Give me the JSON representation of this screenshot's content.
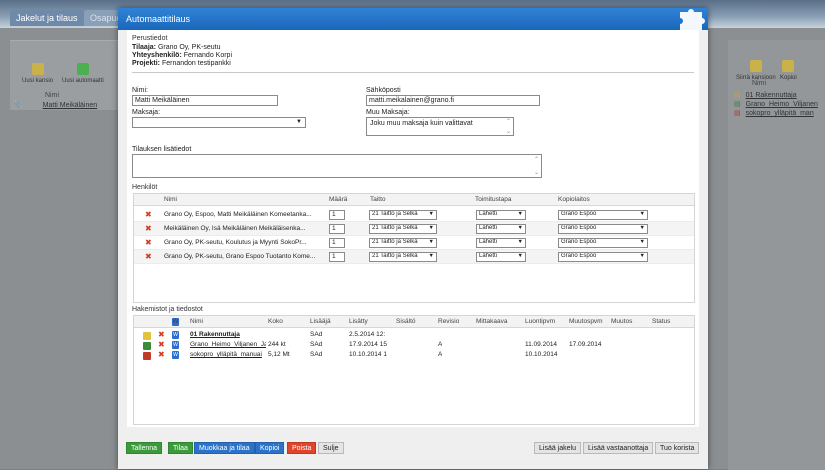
{
  "background": {
    "tabs": [
      "Jakelut ja tilaus",
      "Osapuo"
    ],
    "left_toolbar": [
      "Uusi kansio",
      "Uusi automaatti"
    ],
    "left_list_header": "Nimi",
    "left_list_item": "Matti Meikäläinen",
    "right_toolbar": [
      "Siirrä kansioon",
      "Kopioi"
    ],
    "right_list_header": "Nimi",
    "right_list_items": [
      "01 Rakennuttaja",
      "Grano_Heimo_Viljanen",
      "sokopro_ylläpitä_man"
    ]
  },
  "modal": {
    "title": "Automaattitilaus",
    "basic": {
      "heading": "Perustiedot",
      "tilaaja_label": "Tilaaja:",
      "tilaaja_value": "Grano Oy, PK-seutu",
      "contact_label": "Yhteyshenkilö:",
      "contact_value": "Fernando Korpi",
      "project_label": "Projekti:",
      "project_value": "Fernandon testipankki"
    },
    "form": {
      "name_label": "Nimi:",
      "name_value": "Matti Meikäläinen",
      "email_label": "Sähköposti",
      "email_value": "matti.meikalainen@grano.fi",
      "payer_label": "Maksaja:",
      "payer_value": "",
      "other_payer_label": "Muu Maksaja:",
      "other_payer_value": "Joku muu maksaja kuin valittavat",
      "extra_label": "Tilauksen lisätiedot",
      "extra_value": ""
    },
    "persons": {
      "heading": "Henkilöt",
      "columns": [
        "Nimi",
        "Määrä",
        "Taitto",
        "Toimitustapa",
        "Kopiolaitos"
      ],
      "rows": [
        {
          "name": "Grano Oy, Espoo, Matti Meikäläinen Komeetanka...",
          "qty": "1",
          "taitto": "21 Taitto ja Selkä",
          "delivery": "Lähetti",
          "lab": "Grano Espoo"
        },
        {
          "name": "Meikäläinen Oy, Isä Meikäläinen Meikäläisenka...",
          "qty": "1",
          "taitto": "21 Taitto ja Selkä",
          "delivery": "Lähetti",
          "lab": "Grano Espoo"
        },
        {
          "name": "Grano Oy, PK-seutu, Koulutus ja Myynti SokoPr...",
          "qty": "1",
          "taitto": "21 Taitto ja Selkä",
          "delivery": "Lähetti",
          "lab": "Grano Espoo"
        },
        {
          "name": "Grano Oy, PK-seutu, Grano Espoo Tuotanto Kome...",
          "qty": "1",
          "taitto": "21 Taitto ja Selkä",
          "delivery": "Lähetti",
          "lab": "Grano Espoo"
        }
      ]
    },
    "files": {
      "heading": "Hakemistot ja tiedostot",
      "columns": [
        "Nimi",
        "Koko",
        "Lisääjä",
        "Lisätty",
        "Sisältö",
        "Revisio",
        "Mittakaava",
        "Luontipvm",
        "Muutospvm",
        "Muutos",
        "Status"
      ],
      "rows": [
        {
          "name": "01 Rakennuttaja",
          "size": "",
          "adder": "SAd",
          "added": "2.5.2014 12:",
          "revision": "",
          "created": "",
          "modified": "",
          "kind": "folder"
        },
        {
          "name": "Grano_Heimo_Viljanen_Ja",
          "size": "244 kt",
          "adder": "SAd",
          "added": "17.9.2014 15",
          "revision": "A",
          "created": "11.09.2014",
          "modified": "17.09.2014",
          "kind": "doc"
        },
        {
          "name": "sokopro_ylläpitä_manuai",
          "size": "5,12 Mt",
          "adder": "SAd",
          "added": "10.10.2014 1",
          "revision": "A",
          "created": "10.10.2014",
          "modified": "",
          "kind": "pdf"
        }
      ]
    },
    "buttons_left": [
      {
        "label": "Tallenna",
        "color": "#3b9b3b"
      },
      {
        "label": "Tilaa",
        "color": "#3b9b3b"
      },
      {
        "label": "Muokkaa ja tilaa",
        "color": "#2a73c9"
      },
      {
        "label": "Kopioi",
        "color": "#2a73c9"
      },
      {
        "label": "Poista",
        "color": "#e0452c"
      },
      {
        "label": "Sulje",
        "color": "#e4e4e4"
      }
    ],
    "buttons_right": [
      "Lisää jakelu",
      "Lisää vastaanottaja",
      "Tuo korista"
    ]
  }
}
